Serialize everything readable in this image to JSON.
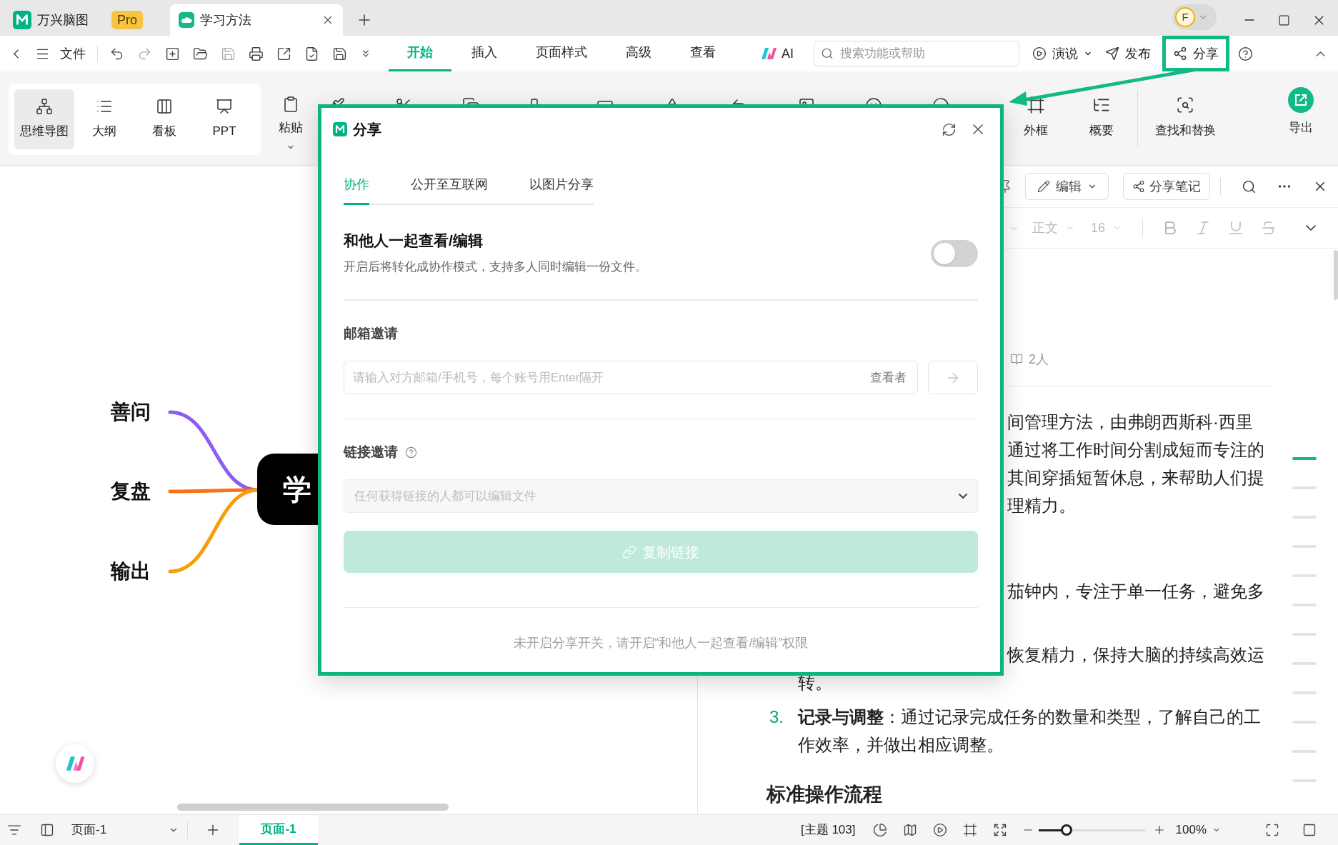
{
  "title_bar": {
    "app_name": "万兴脑图",
    "badge": "Pro",
    "document_tab": {
      "label": "学习方法",
      "selected": true
    },
    "avatar": "F"
  },
  "menu_bar": {
    "file": "文件",
    "tabs": [
      {
        "label": "开始",
        "selected": true
      },
      {
        "label": "插入",
        "selected": false
      },
      {
        "label": "页面样式",
        "selected": false
      },
      {
        "label": "高级",
        "selected": false
      },
      {
        "label": "查看",
        "selected": false
      }
    ],
    "ai": "AI",
    "search": {
      "placeholder": "搜索功能或帮助"
    },
    "actions": [
      {
        "label": "演说",
        "kind": "dropdown"
      },
      {
        "label": "发布",
        "kind": "plain"
      },
      {
        "label": "分享",
        "kind": "highlighted"
      }
    ]
  },
  "ribbon": {
    "views": [
      {
        "label": "思维导图",
        "selected": true
      },
      {
        "label": "大纲",
        "selected": false
      },
      {
        "label": "看板",
        "selected": false
      },
      {
        "label": "PPT",
        "selected": false
      }
    ],
    "paste": "粘贴",
    "tools": [
      "外框",
      "概要",
      "查找和替换"
    ],
    "export": "导出"
  },
  "mind_map": {
    "center": "学",
    "branches": [
      {
        "label": "善问",
        "color": "#8b5cf6"
      },
      {
        "label": "复盘",
        "color": "#f97316"
      },
      {
        "label": "输出",
        "color": "#f59e0b"
      }
    ]
  },
  "share_dialog": {
    "title": "分享",
    "tabs": [
      {
        "label": "协作",
        "selected": true
      },
      {
        "label": "公开至互联网",
        "selected": false
      },
      {
        "label": "以图片分享",
        "selected": false
      }
    ],
    "collaboration": {
      "title": "和他人一起查看/编辑",
      "description": "开启后将转化成协作模式，支持多人同时编辑一份文件。",
      "on": false
    },
    "email_invite": {
      "title": "邮箱邀请",
      "placeholder": "请输入对方邮箱/手机号，每个账号用Enter隔开",
      "role": "查看者"
    },
    "link_invite": {
      "title": "链接邀请",
      "permission": "任何获得链接的人都可以编辑文件",
      "disabled": true
    },
    "copy_button": {
      "label": "复制链接",
      "disabled": true
    },
    "footer": "未开启分享开关，请开启“和他人一起查看/编辑”权限"
  },
  "notes_panel": {
    "edit_button": "编辑",
    "share_button": "分享笔记",
    "style": "正文",
    "font_size": "16",
    "readers": "2人",
    "paragraph_fragment": [
      "间管理方法，由弗朗西斯科·西里",
      "通过将工作时间分割成短而专注的",
      "其间穿插短暂休息，来帮助人们提",
      "理精力。"
    ],
    "list_fragments": [
      [
        "茄钟内，专注于单一任务，避免多"
      ],
      [
        "恢复精力，保持大脑的持续高效运",
        "转。"
      ]
    ],
    "list_item": {
      "number": "3.",
      "text": "**记录与调整**：通过记录完成任务的数量和类型，了解自己的工作效率，并做出相应调整。"
    },
    "heading": "标准操作流程",
    "outline": [
      {
        "selected": true
      },
      {
        "selected": false
      },
      {
        "selected": false
      },
      {
        "selected": false
      },
      {
        "selected": false
      },
      {
        "selected": false
      },
      {
        "selected": false
      },
      {
        "selected": false
      },
      {
        "selected": false
      },
      {
        "selected": false
      },
      {
        "selected": false
      },
      {
        "selected": false
      }
    ]
  },
  "status_bar": {
    "page_select": "页面-1",
    "page_tabs": [
      {
        "label": "页面-1",
        "selected": true
      }
    ],
    "topic_count": "[主题 103]",
    "zoom": {
      "level": 0.26,
      "reading": "100%"
    }
  }
}
